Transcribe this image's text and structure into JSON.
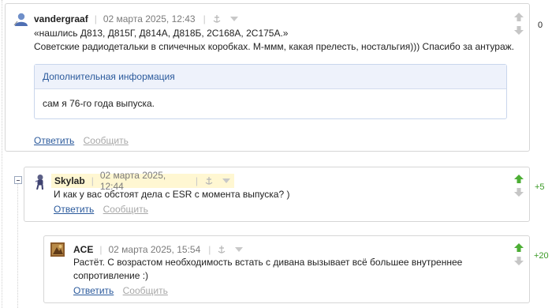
{
  "comments": [
    {
      "author": "vandergraaf",
      "date": "02 марта 2025, 12:43",
      "lines": [
        "«нашлись Д813, Д815Г, Д814А, Д818Б, 2С168А, 2С175А.»",
        "Советские радиодетальки в спичечных коробках. М-ммм, какая прелесть, ностальгия))) Спасибо за антураж."
      ],
      "info": {
        "title": "Дополнительная информация",
        "text": "сам я 76-го года выпуска."
      },
      "reply_label": "Ответить",
      "report_label": "Сообщить",
      "score": "0",
      "score_color": "#222222"
    },
    {
      "author": "Skylab",
      "date": "02 марта 2025, 12:44",
      "lines": [
        "И как у вас обстоят дела с ESR с момента выпуска? )"
      ],
      "reply_label": "Ответить",
      "report_label": "Сообщить",
      "score": "+5",
      "score_color": "#3a9a25"
    },
    {
      "author": "ACE",
      "date": "02 марта 2025, 15:54",
      "lines": [
        "Растёт. С возрастом необходимость встать с дивана вызывает всё большее внутреннее",
        "сопротивление :)"
      ],
      "reply_label": "Ответить",
      "report_label": "Сообщить",
      "score": "+20",
      "score_color": "#3a9a25"
    }
  ],
  "colors": {
    "link": "#2b5a9c",
    "muted_link": "#a8a8a8",
    "vote_up_active": "#4cae34",
    "vote_inactive": "#c6c6c6",
    "highlight": "#fff7d2"
  }
}
